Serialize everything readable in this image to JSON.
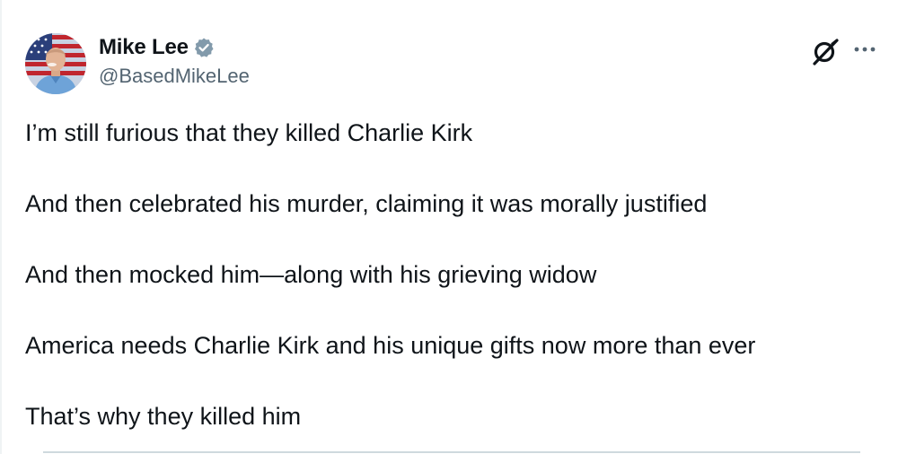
{
  "author": {
    "display_name": "Mike Lee",
    "handle": "@BasedMikeLee",
    "verified": true
  },
  "tweet": {
    "lines": [
      "I’m still furious that they killed Charlie Kirk",
      "And then celebrated his murder, claiming it was morally justified",
      "And then mocked him—along with his grieving widow",
      "America needs Charlie Kirk and his unique gifts now more than ever",
      "That’s why they killed him"
    ]
  },
  "icons": {
    "verified": "verified-badge-icon",
    "grok": "grok-icon",
    "more": "more-options-icon"
  },
  "colors": {
    "text": "#0f1419",
    "secondary": "#536471",
    "verified_badge": "#829aab"
  }
}
